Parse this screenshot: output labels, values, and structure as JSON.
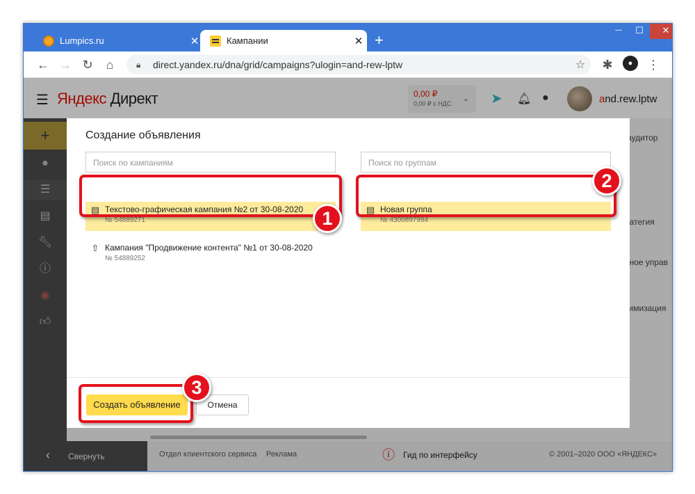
{
  "browser": {
    "tabs": [
      {
        "title": "Lumpics.ru",
        "close": "✕"
      },
      {
        "title": "Кампании",
        "close": "✕"
      }
    ],
    "new_tab": "+",
    "window_controls": {
      "minimize": "—",
      "maximize": "☐",
      "close": "✕"
    },
    "url": "direct.yandex.ru/dna/grid/campaigns?ulogin=and-rew-lptw"
  },
  "header": {
    "logo_ya": "Яндекс",
    "logo_product": " Директ",
    "balance_amount": "0,00 ₽",
    "balance_nds": "0,00 ₽ с НДС",
    "username_first": "a",
    "username_rest": "nd.rew.lptw"
  },
  "background": {
    "audience_fragment": "аудитор",
    "strategy_fragment": "ратегия",
    "management_fragment": "нное управ",
    "optimization_fragment": "тимизация"
  },
  "modal": {
    "title": "Создание объявления",
    "campaign_search_placeholder": "Поиск по кампаниям",
    "group_search_placeholder": "Поиск по группам",
    "campaigns": [
      {
        "name": "Текстово-графическая кампания №2 от 30-08-2020",
        "number": "№ 54889271"
      },
      {
        "name": "Кампания \"Продвижение контента\" №1 от 30-08-2020",
        "number": "№ 54889252"
      }
    ],
    "groups": [
      {
        "name": "Новая группа",
        "number": "№ 4300897994"
      }
    ],
    "create_button": "Создать объявление",
    "cancel_button": "Отмена"
  },
  "annotations": [
    "1",
    "2",
    "3"
  ],
  "sidebar": {
    "collapse_label": "Свернуть"
  },
  "footer": {
    "client_service": "Отдел клиентского сервиса",
    "ads": "Реклама",
    "guide": "Гид по интерфейсу",
    "copyright": "© 2001–2020 ООО «ЯНДЕКС»"
  },
  "colors": {
    "accent": "#ffdb4d",
    "selected": "#feeb9c",
    "annotation": "#e3111d",
    "browser": "#3c78d8"
  }
}
